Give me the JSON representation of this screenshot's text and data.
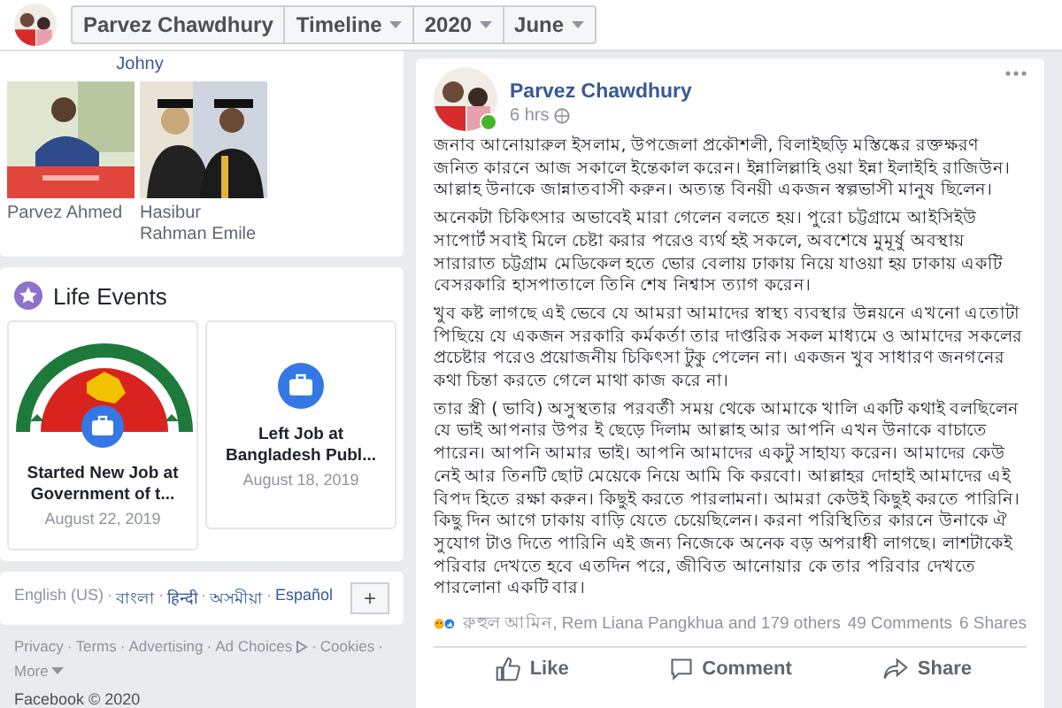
{
  "header": {
    "name": "Parvez Chawdhury",
    "menus": [
      {
        "label": "Timeline"
      },
      {
        "label": "2020"
      },
      {
        "label": "June"
      }
    ]
  },
  "photos": {
    "caption_above": "Johny",
    "items": [
      {
        "name": "Parvez Ahmed",
        "kind": "picture"
      },
      {
        "name": "Hasibur Rahman Emile",
        "kind": "picture"
      }
    ]
  },
  "life_events": {
    "title": "Life Events",
    "items": [
      {
        "kind": "picture",
        "title": "Started New Job at Government of t...",
        "date": "August 22, 2019"
      },
      {
        "kind": "plain",
        "title": "Left Job at Bangladesh Publ...",
        "date": "August 18, 2019"
      }
    ]
  },
  "languages": {
    "separator": "·",
    "items": [
      "English (US)",
      "বাংলা",
      "हिन्दी",
      "অসমীয়া",
      "Español"
    ],
    "more": "+"
  },
  "footer": {
    "separator": "·",
    "links": [
      "Privacy",
      "Terms",
      "Advertising",
      "Ad Choices",
      "Cookies",
      "More"
    ],
    "copyright": "Facebook © 2020"
  },
  "post": {
    "author": "Parvez Chawdhury",
    "time": "6 hrs",
    "online": true,
    "paragraphs": [
      "জনাব আনোয়ারুল ইসলাম, উপজেলা প্রকৌশলী, বিলাইছড়ি মস্তিষ্কের রক্তক্ষরণ জনিত কারনে আজ সকালে ইন্তেকাল করেন। ইন্নালিল্লাহি ওয়া ইন্না ইলাইহি রাজিউন। আল্লাহ উনাকে জান্নাতবাসী করুন। অত্যন্ত বিনয়ী একজন স্বল্পভাসী মানুষ ছিলেন।",
      "অনেকটা চিকিৎসার অভাবেই মারা গেলেন বলতে হয়। পুরো চট্টগ্রামে আইসিইউ সাপোর্ট সবাই মিলে চেষ্টা করার পরেও ব্যর্থ হই সকলে, অবশেষে মুমূর্ষু অবস্থায় সারারাত চট্টগ্রাম মেডিকেল হতে ভোর বেলায় ঢাকায় নিয়ে যাওয়া হয় ঢাকায় একটি বেসরকারি হাসপাতালে তিনি শেষ নিশ্বাস ত্যাগ করেন।",
      "খুব কষ্ট লাগছে এই ভেবে যে আমরা আমাদের স্বাস্থ্য ব্যবস্থার উন্নয়নে এখনো এতোটা পিছিয়ে যে একজন সরকারি কর্মকর্তা তার দাপ্তরিক সকল মাধ্যমে ও আমাদের সকলের প্রচেষ্টার পরেও প্রয়োজনীয় চিকিৎসা টুকু পেলেন না। একজন খুব সাধারণ জনগনের কথা চিন্তা করতে গেলে মাথা কাজ করে না।",
      "তার স্ত্রী ( ভাবি) অসুস্থতার পরবর্তী সময় থেকে আমাকে খালি একটি কথাই বলছিলেন যে ভাই আপনার উপর ই ছেড়ে দিলাম আল্লাহ আর আপনি এখন উনাকে বাচাতে পারেন। আপনি আমার ভাই। আপনি আমাদের একটু সাহায্য করেন। আমাদের কেউ নেই আর তিনটি ছোট মেয়েকে নিয়ে আমি কি করবো। আল্লাহর দোহাই আমাদের এই বিপদ হিতে রক্ষা করুন। কিছুই করতে পারলামনা। আমরা কেউই কিছুই করতে পারিনি। কিছু দিন আগে ঢাকায় বাড়ি যেতে চেয়েছিলেন। করনা পরিস্থিতির কারনে উনাকে ঐ সুযোগ টাও দিতে পারিনি এই জন্য নিজেকে অনেক বড় অপরাধী লাগছে। লাশটাকেই পরিবার দেখতে হবে এতদিন পরে, জীবিত আনোয়ার কে তার পরিবার দেখতে পারলোনা একটি বার।"
    ],
    "reactions": "রুহুল আমিন, Rem Liana Pangkhua and 179 others",
    "comments": "49 Comments",
    "shares": "6 Shares",
    "actions": [
      "Like",
      "Comment",
      "Share"
    ]
  }
}
